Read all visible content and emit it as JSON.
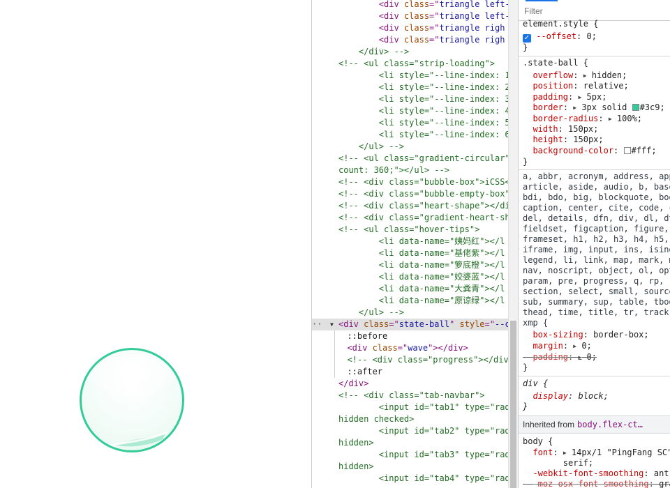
{
  "preview": {
    "ball": {
      "border_color": "#33cc99",
      "fill_color": "#ffffff",
      "wave_color": "#33cc99"
    }
  },
  "elements": {
    "lines": [
      [
        "        ",
        [
          "tag",
          "<div "
        ],
        [
          "an",
          "class"
        ],
        [
          "tag",
          "=\""
        ],
        [
          "av",
          "triangle left-"
        ]
      ],
      [
        "        ",
        [
          "tag",
          "<div "
        ],
        [
          "an",
          "class"
        ],
        [
          "tag",
          "=\""
        ],
        [
          "av",
          "triangle left-"
        ]
      ],
      [
        "        ",
        [
          "tag",
          "<div "
        ],
        [
          "an",
          "class"
        ],
        [
          "tag",
          "=\""
        ],
        [
          "av",
          "triangle righ"
        ]
      ],
      [
        "        ",
        [
          "tag",
          "<div "
        ],
        [
          "an",
          "class"
        ],
        [
          "tag",
          "=\""
        ],
        [
          "av",
          "triangle righ"
        ]
      ],
      [
        "    ",
        [
          "cm",
          "</div> -->"
        ]
      ],
      [
        "",
        [
          "cm",
          "<!-- <ul class=\"strip-loading\">"
        ]
      ],
      [
        "        ",
        [
          "cm",
          "<li style=\"--line-index: 1"
        ]
      ],
      [
        "        ",
        [
          "cm",
          "<li style=\"--line-index: 2"
        ]
      ],
      [
        "        ",
        [
          "cm",
          "<li style=\"--line-index: 3"
        ]
      ],
      [
        "        ",
        [
          "cm",
          "<li style=\"--line-index: 4"
        ]
      ],
      [
        "        ",
        [
          "cm",
          "<li style=\"--line-index: 5"
        ]
      ],
      [
        "        ",
        [
          "cm",
          "<li style=\"--line-index: 6"
        ]
      ],
      [
        "    ",
        [
          "cm",
          "</ul> -->"
        ]
      ],
      [
        "",
        [
          "cm",
          "<!-- <ul class=\"gradient-circular\""
        ]
      ],
      [
        "",
        [
          "cm",
          "count: 360;\"></ul> -->"
        ]
      ],
      [
        "",
        [
          "cm",
          "<!-- <div class=\"bubble-box\">iCSS<"
        ]
      ],
      [
        "",
        [
          "cm",
          "<!-- <div class=\"bubble-empty-box\""
        ]
      ],
      [
        "",
        [
          "cm",
          "<!-- <div class=\"heart-shape\"></di"
        ]
      ],
      [
        "",
        [
          "cm",
          "<!-- <div class=\"gradient-heart-sh"
        ]
      ],
      [
        "",
        [
          "cm",
          "<!-- <ul class=\"hover-tips\">"
        ]
      ],
      [
        "        ",
        [
          "cm",
          "<li data-name=\"姨妈红\"></l"
        ]
      ],
      [
        "        ",
        [
          "cm",
          "<li data-name=\"基佬紫\"></l"
        ]
      ],
      [
        "        ",
        [
          "cm",
          "<li data-name=\"箩底橙\"></l"
        ]
      ],
      [
        "        ",
        [
          "cm",
          "<li data-name=\"姣婆蓝\"></l"
        ]
      ],
      [
        "        ",
        [
          "cm",
          "<li data-name=\"大粪青\"></l"
        ]
      ],
      [
        "        ",
        [
          "cm",
          "<li data-name=\"原谅绿\"></l"
        ]
      ],
      [
        "    ",
        [
          "cm",
          "</ul> -->"
        ]
      ],
      [
        "",
        [
          "tag",
          "<div "
        ],
        [
          "an",
          "class"
        ],
        [
          "tag",
          "=\""
        ],
        [
          "av",
          "state-ball"
        ],
        [
          "tag",
          "\" "
        ],
        [
          "an",
          "style"
        ],
        [
          "tag",
          "=\""
        ],
        [
          "av",
          "--c"
        ]
      ],
      [
        "  ",
        [
          "pl",
          "::before"
        ]
      ],
      [
        "  ",
        [
          "tag",
          "<div "
        ],
        [
          "an",
          "class"
        ],
        [
          "tag",
          "=\""
        ],
        [
          "av",
          "wave"
        ],
        [
          "tag",
          "\"></div>"
        ]
      ],
      [
        "  ",
        [
          "cm",
          "<!-- <div class=\"progress\"></div"
        ]
      ],
      [
        "  ",
        [
          "pl",
          "::after"
        ]
      ],
      [
        "",
        [
          "tag",
          "</div>"
        ]
      ],
      [
        "",
        [
          "cm",
          "<!-- <div class=\"tab-navbar\">"
        ]
      ],
      [
        "        ",
        [
          "cm",
          "<input id=\"tab1\" type=\"rad"
        ]
      ],
      [
        "",
        [
          "cm",
          "hidden checked>"
        ]
      ],
      [
        "        ",
        [
          "cm",
          "<input id=\"tab2\" type=\"rad"
        ]
      ],
      [
        "",
        [
          "cm",
          "hidden>"
        ]
      ],
      [
        "        ",
        [
          "cm",
          "<input id=\"tab3\" type=\"rad"
        ]
      ],
      [
        "",
        [
          "cm",
          "hidden>"
        ]
      ],
      [
        "        ",
        [
          "cm",
          "<input id=\"tab4\" type=\"rad"
        ]
      ]
    ]
  },
  "styles": {
    "filter_placeholder": "Filter",
    "element_style": {
      "selector": "element.style {",
      "prop": "--offset",
      "value": "0;",
      "close": "}"
    },
    "state_ball": {
      "selector": ".state-ball {",
      "rules": [
        {
          "prop": "overflow",
          "arrow": true,
          "value": "hidden;"
        },
        {
          "prop": "position",
          "arrow": false,
          "value": "relative;"
        },
        {
          "prop": "padding",
          "arrow": true,
          "value": "5px;"
        },
        {
          "prop": "border",
          "arrow": true,
          "value": "3px solid ",
          "swatch": "#33cc99",
          "value2": "#3c9;"
        },
        {
          "prop": "border-radius",
          "arrow": true,
          "value": "100%;"
        },
        {
          "prop": "width",
          "arrow": false,
          "value": "150px;"
        },
        {
          "prop": "height",
          "arrow": false,
          "value": "150px;"
        },
        {
          "prop": "background-color",
          "arrow": false,
          "value": "",
          "swatch": "#ffffff",
          "value2": "#fff;"
        }
      ],
      "close": "}"
    },
    "reset_selectors": [
      "a, abbr, acronym, address, app",
      "article, aside, audio, b, base",
      "bdi, bdo, big, blockquote, bod",
      "caption, center, cite, code, c",
      "del, details, dfn, div, dl, dt",
      "fieldset, figcaption, figure,",
      "frameset, h1, h2, h3, h4, h5,",
      "iframe, img, input, ins, isind",
      "legend, li, link, map, mark, m",
      "nav, noscript, object, ol, opt",
      "param, pre, progress, q, rp, r",
      "section, select, small, source",
      "sub, summary, sup, table, tbod",
      "thead, time, title, tr, track,",
      "xmp {"
    ],
    "reset_rules": [
      {
        "prop": "box-sizing",
        "arrow": false,
        "value": "border-box;",
        "struck": false
      },
      {
        "prop": "margin",
        "arrow": true,
        "value": "0;",
        "struck": false
      },
      {
        "prop": "padding",
        "arrow": true,
        "value": "0;",
        "struck": true
      }
    ],
    "reset_close": "}",
    "div_ua": {
      "selector": "div {",
      "prop": "display",
      "value": "block;",
      "close": "}"
    },
    "inherited": {
      "label": "Inherited from",
      "link": "body.flex-ct…"
    },
    "body_rule": {
      "selector": "body {",
      "lines": [
        {
          "prop": "font",
          "arrow": true,
          "value": "14px/1 \"PingFang SC\""
        },
        {
          "prop": "",
          "arrow": false,
          "value": "serif;"
        },
        {
          "prop": "-webkit-font-smoothing",
          "arrow": false,
          "value": "ant"
        },
        {
          "prop": "-moz-osx-font-smoothing",
          "arrow": false,
          "value": "gra",
          "struck": true
        }
      ]
    }
  }
}
